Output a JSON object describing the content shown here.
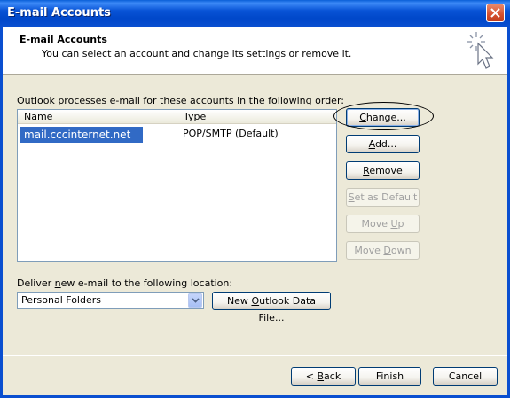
{
  "window": {
    "title": "E-mail Accounts"
  },
  "header": {
    "title": "E-mail Accounts",
    "subtitle": "You can select an account and change its settings or remove it."
  },
  "accounts": {
    "label": "Outlook processes e-mail for these accounts in the following order:",
    "columns": [
      "Name",
      "Type"
    ],
    "rows": [
      {
        "name": "mail.cccinternet.net",
        "type": "POP/SMTP (Default)"
      }
    ]
  },
  "side_buttons": {
    "change": {
      "pre": "",
      "key": "C",
      "post": "hange..."
    },
    "add": {
      "pre": "",
      "key": "A",
      "post": "dd..."
    },
    "remove": {
      "pre": "",
      "key": "R",
      "post": "emove"
    },
    "set_default": {
      "pre": "",
      "key": "S",
      "post": "et as Default"
    },
    "move_up": {
      "pre": "Move ",
      "key": "U",
      "post": "p"
    },
    "move_down": {
      "pre": "Move ",
      "key": "D",
      "post": "own"
    }
  },
  "deliver": {
    "label_pre": "Deliver ",
    "label_key": "n",
    "label_post": "ew e-mail to the following location:",
    "selected": "Personal Folders",
    "new_file": {
      "pre": "New ",
      "key": "O",
      "post": "utlook Data File..."
    }
  },
  "footer_buttons": {
    "back": {
      "pre": "< ",
      "key": "B",
      "post": "ack"
    },
    "finish": "Finish",
    "cancel": "Cancel"
  },
  "colors": {
    "title_bar": "#0a4fd0",
    "selection": "#316ac5",
    "dialog_bg": "#ece9d8"
  }
}
